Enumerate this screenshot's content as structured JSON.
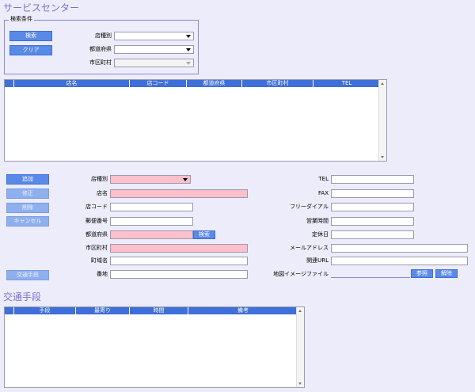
{
  "page_title": "サービスセンター",
  "search": {
    "legend": "検索条件",
    "search_button": "検索",
    "clear_button": "クリア",
    "store_type_label": "店種別",
    "prefecture_label": "都道府県",
    "city_label": "市区町村"
  },
  "store_table": {
    "columns": [
      "店名",
      "店コード",
      "都道府県",
      "市区町村",
      "TEL"
    ]
  },
  "actions": {
    "add": "追加",
    "edit": "修正",
    "delete": "削除",
    "cancel": "キャンセル",
    "transport": "交通手段"
  },
  "form": {
    "store_type": "店種別",
    "store_name": "店名",
    "store_code": "店コード",
    "postal_code": "郵便番号",
    "prefecture": "都道府県",
    "prefecture_search": "検索",
    "city": "市区町村",
    "town": "町域名",
    "address": "番地",
    "tel": "TEL",
    "fax": "FAX",
    "free_dial": "フリーダイアル",
    "business_hours": "営業時間",
    "holiday": "定休日",
    "email": "メールアドレス",
    "related_url": "関連URL",
    "map_image_file": "地図イメージファイル",
    "browse_button": "参照",
    "remove_button": "解除"
  },
  "transport_section": {
    "title": "交通手段",
    "columns": [
      "手段",
      "最寄り",
      "時間",
      "備考"
    ]
  }
}
